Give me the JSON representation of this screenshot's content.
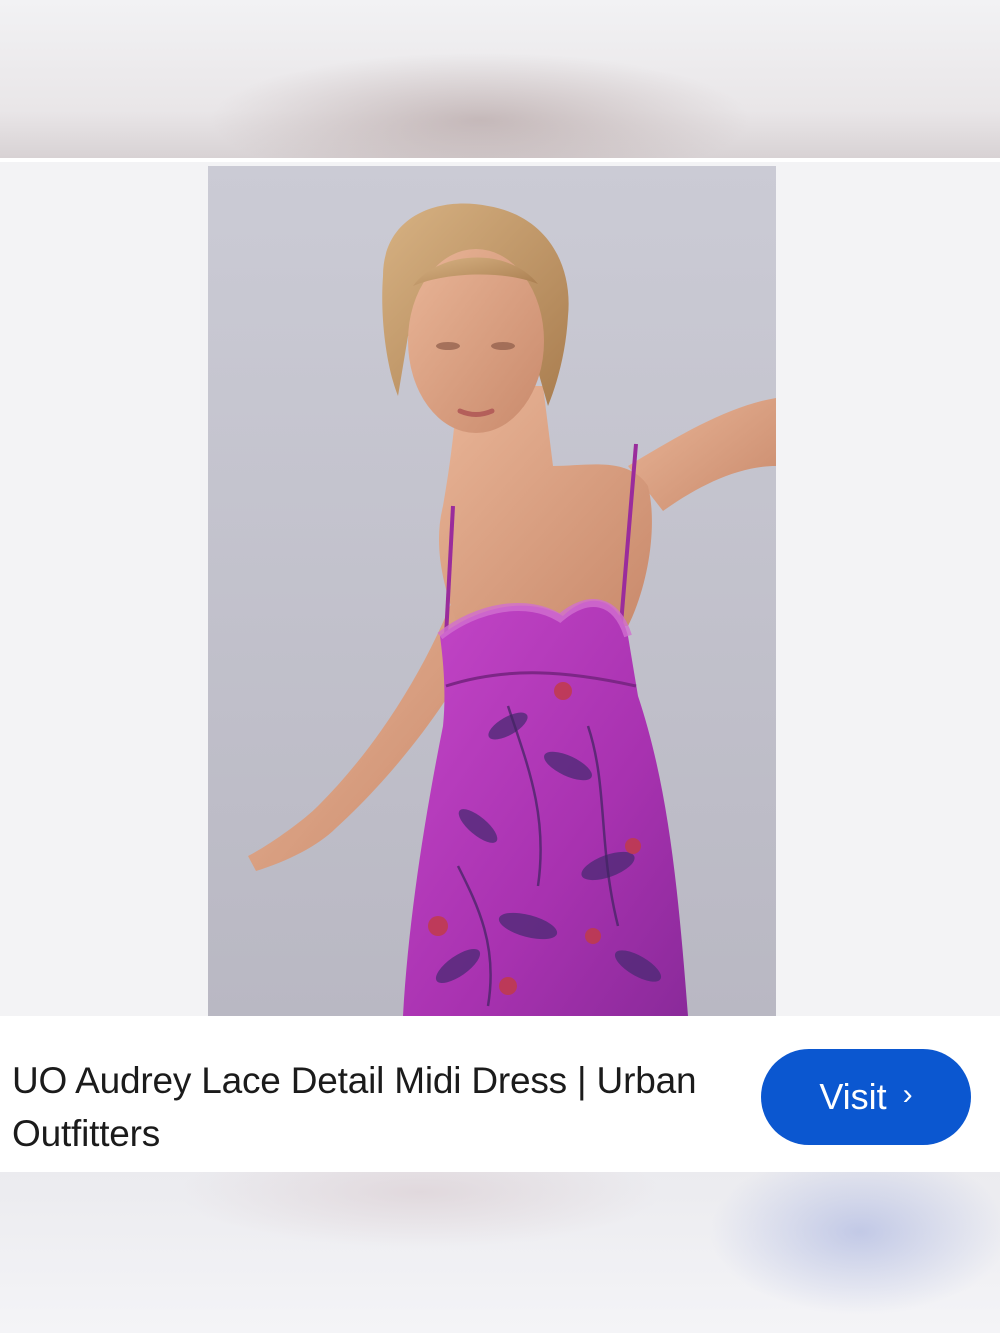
{
  "result": {
    "title": "UO Audrey Lace Detail Midi Dress | Urban Outfitters",
    "visit_label": "Visit",
    "chevron_icon": "chevron-right-icon",
    "image_subject": "model-in-purple-floral-slip-dress"
  },
  "colors": {
    "accent": "#0b57d0",
    "dress": "#b43ab8",
    "background": "#c9c9d3"
  }
}
